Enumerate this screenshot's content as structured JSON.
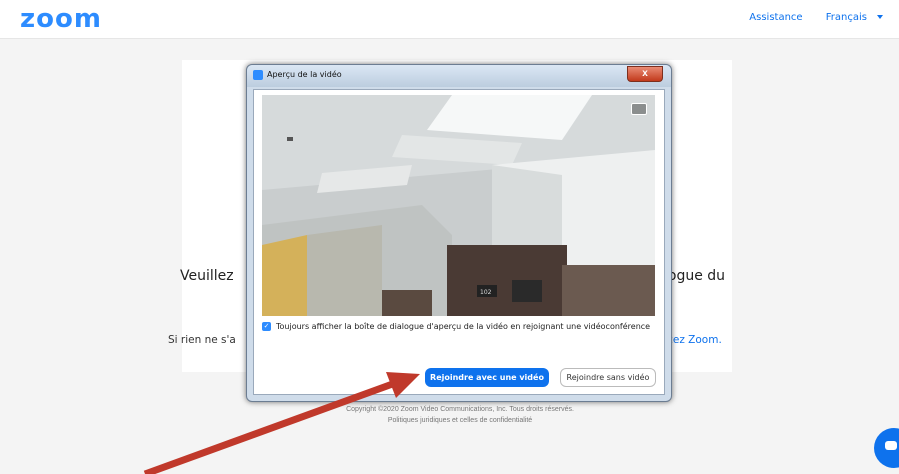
{
  "header": {
    "logo": "zoom",
    "links": [
      "Assistance",
      "Français"
    ]
  },
  "card": {
    "message_left": "Veuillez",
    "message_right": "logue du",
    "sub_left": "Si rien ne s'a",
    "sub_link": "ancez Zoom."
  },
  "footer": {
    "line1": "Copyright ©2020 Zoom Video Communications, Inc. Tous droits réservés.",
    "line2": "Politiques juridiques et celles de confidentialité"
  },
  "dialog": {
    "title": "Aperçu de la vidéo",
    "close_label": "x",
    "checkbox_label": "Toujours afficher la boîte de dialogue d'aperçu de la vidéo en rejoignant une vidéoconférence",
    "checkbox_checked": true,
    "join_with_video": "Rejoindre avec une vidéo",
    "join_without_video": "Rejoindre sans vidéo",
    "room_number": "102"
  },
  "colors": {
    "brand": "#2d8cff",
    "primary_button": "#0e72ed",
    "annotation_arrow": "#c0392b"
  },
  "icons": {
    "camera_toggle": "camera-switch-icon",
    "chat": "chat-icon"
  }
}
